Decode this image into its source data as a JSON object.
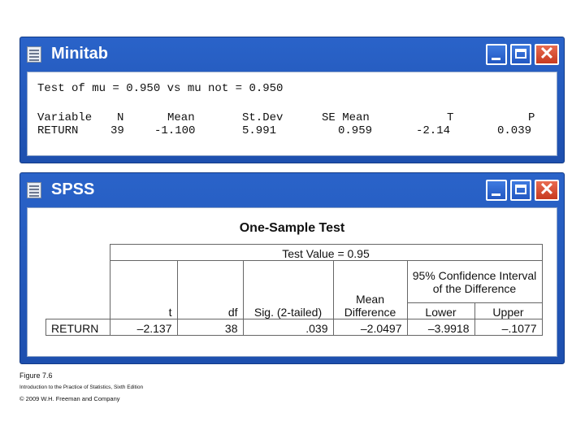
{
  "minitab": {
    "title": "Minitab",
    "test_line": "Test of mu = 0.950 vs mu not = 0.950",
    "headers": [
      "Variable",
      "N",
      "Mean",
      "St.Dev",
      "SE Mean",
      "T",
      "P"
    ],
    "row": [
      "RETURN",
      "39",
      "-1.100",
      "5.991",
      "0.959",
      "-2.14",
      "0.039"
    ]
  },
  "spss": {
    "title": "SPSS",
    "heading": "One-Sample Test",
    "test_value": "Test Value = 0.95",
    "ci_header": "95% Confidence Interval of the Difference",
    "columns": {
      "t": "t",
      "df": "df",
      "sig": "Sig. (2-tailed)",
      "mean_diff": "Mean Difference",
      "lower": "Lower",
      "upper": "Upper"
    },
    "row": {
      "label": "RETURN",
      "t": "–2.137",
      "df": "38",
      "sig": ".039",
      "mean_diff": "–2.0497",
      "lower": "–3.9918",
      "upper": "–.1077"
    }
  },
  "window_controls": {
    "minimize": "minimize-icon",
    "maximize": "maximize-icon",
    "close": "close-icon",
    "close_glyph": "✕"
  },
  "colors": {
    "titlebar": "#2257c2",
    "close_button": "#d9492e",
    "content_bg": "#ffffff"
  },
  "caption": {
    "figure": "Figure 7.6",
    "book": "Introduction to the Practice of Statistics, Sixth Edition",
    "copyright": "© 2009 W.H. Freeman and Company"
  }
}
